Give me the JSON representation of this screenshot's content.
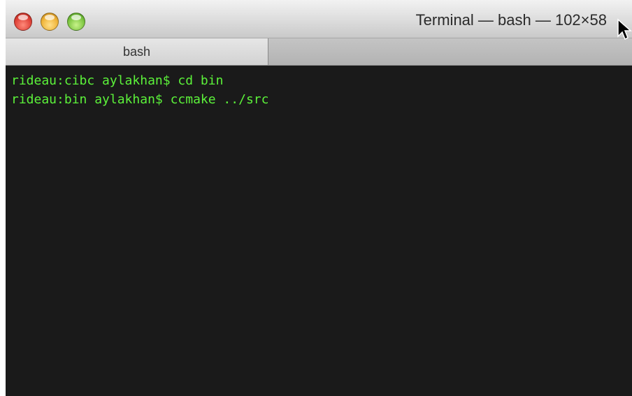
{
  "window": {
    "title": "Terminal — bash — 102×58"
  },
  "tabs": [
    {
      "label": "bash"
    }
  ],
  "terminal": {
    "lines": [
      "rideau:cibc aylakhan$ cd bin",
      "rideau:bin aylakhan$ ccmake ../src"
    ],
    "text_color": "#5cf23a",
    "background_color": "#1a1a1a"
  },
  "icons": {
    "close": "close-icon",
    "minimize": "minimize-icon",
    "zoom": "zoom-icon",
    "cursor": "mouse-pointer-icon"
  }
}
